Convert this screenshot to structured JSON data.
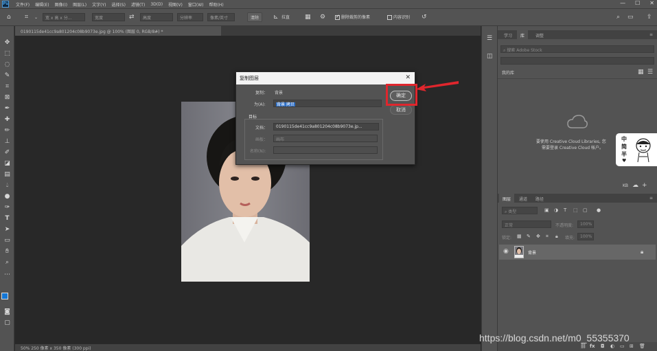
{
  "app": {
    "logo": "Ps"
  },
  "menu": [
    "文件(F)",
    "编辑(E)",
    "图像(I)",
    "图层(L)",
    "文字(Y)",
    "选择(S)",
    "滤镜(T)",
    "3D(D)",
    "视图(V)",
    "窗口(W)",
    "帮助(H)"
  ],
  "options": {
    "field1": "宽 x 高 x 分…",
    "field2": "宽度",
    "field3": "高度",
    "field4": "分辨率",
    "unit": "像素/英寸",
    "clear": "清除",
    "straighten": "拉直",
    "delete_cropped": "删除裁剪的像素",
    "content_aware": "内容识别"
  },
  "document": {
    "tab": "0190115de41cc9a801204c08b9073e.jpg @ 100% (图层 0, RGB/8#) *",
    "status": "50%    250 像素 x 350 像素 (300 ppi)"
  },
  "dialog": {
    "title": "复制图层",
    "source_label": "复制：",
    "source_value": "背景",
    "as_label": "为(A):",
    "as_value": "背景 拷贝",
    "target_section": "目标",
    "doc_label": "文档：",
    "doc_value": "0190115de41cc9a801204c08b9073e.jp...",
    "artboard_label": "画板：",
    "artboard_value": "画布",
    "name_label": "名称(N):",
    "name_value": "",
    "ok": "确定",
    "cancel": "取消"
  },
  "panels": {
    "top_tabs": [
      "学习",
      "库",
      "调整"
    ],
    "search_placeholder": "搜索 Adobe Stock",
    "library_dropdown": "我的库",
    "cc_message_1": "要使用 Creative Cloud Libraries, 您",
    "cc_message_2": "需要登录 Creative Cloud 帐户。",
    "kb": "KB",
    "layer_tabs": [
      "图层",
      "通道",
      "路径"
    ],
    "kind_label": "类型",
    "blend_mode": "正常",
    "opacity_label": "不透明度:",
    "opacity_value": "100%",
    "lock_label": "锁定:",
    "fill_label": "填充:",
    "fill_value": "100%",
    "layer_name": "背景"
  },
  "sticker": {
    "chars": [
      "中",
      "简",
      "半"
    ]
  },
  "watermark": "https://blog.csdn.net/m0_55355370",
  "accent": "#e0262d"
}
